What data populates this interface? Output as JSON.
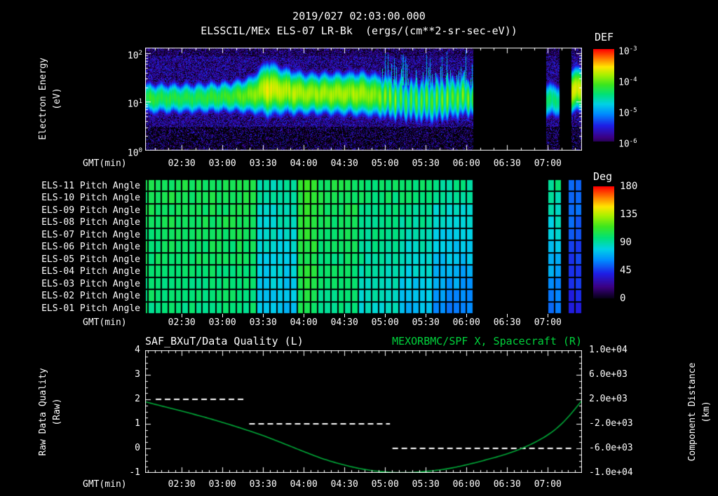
{
  "header": {
    "title": "2019/027 02:03:00.000",
    "subtitle": "ELSSCIL/MEx ELS-07 LR-Bk  (ergs/(cm**2-sr-sec-eV))"
  },
  "time_axis": {
    "label": "GMT(min)",
    "start_hour": 2.05,
    "end_hour": 7.42,
    "tick_hours": [
      2.5,
      3,
      3.5,
      4,
      4.5,
      5,
      5.5,
      6,
      6.5,
      7
    ],
    "tick_labels": [
      "02:30",
      "03:00",
      "03:30",
      "04:00",
      "04:30",
      "05:00",
      "05:30",
      "06:00",
      "06:30",
      "07:00"
    ]
  },
  "colors": {
    "background": "#000000",
    "text": "#ffffff",
    "green_accent": "#00d23c",
    "curve_green": "#00a838"
  },
  "chart_data": [
    {
      "id": "electron_spectrogram",
      "type": "heatmap",
      "ylabel": "Electron Energy\n(eV)",
      "yscale": "log",
      "ylim": [
        1,
        130
      ],
      "ytick_values": [
        1,
        10,
        100
      ],
      "ytick_labels": [
        "10^0",
        "10^1",
        "10^2"
      ],
      "units": "ergs/(cm**2-sr-sec-eV)",
      "colorbar": {
        "label": "DEF",
        "scale": "log",
        "min": 1e-06,
        "max": 0.001,
        "tick_labels": [
          "10^-3",
          "10^-4",
          "10^-5",
          "10^-6"
        ]
      },
      "gaps_hours": [
        [
          6.08,
          6.98
        ],
        [
          7.14,
          7.29
        ]
      ],
      "background_log10_flux_range": [
        -6.35,
        -5.4
      ],
      "striation_window_hours": [
        4.95,
        6.08
      ],
      "high_energy_wisp_hours": [
        4.95,
        6.08
      ],
      "band_keyframes": [
        {
          "t": 2.05,
          "center_ev": 12,
          "sigma_dec": 0.26,
          "peak_log10": -4.25
        },
        {
          "t": 2.6,
          "center_ev": 12,
          "sigma_dec": 0.26,
          "peak_log10": -4.3
        },
        {
          "t": 3.1,
          "center_ev": 13,
          "sigma_dec": 0.26,
          "peak_log10": -4.2
        },
        {
          "t": 3.35,
          "center_ev": 14,
          "sigma_dec": 0.3,
          "peak_log10": -4.0
        },
        {
          "t": 3.55,
          "center_ev": 19,
          "sigma_dec": 0.42,
          "peak_log10": -3.65
        },
        {
          "t": 3.75,
          "center_ev": 17,
          "sigma_dec": 0.36,
          "peak_log10": -3.8
        },
        {
          "t": 4.0,
          "center_ev": 15,
          "sigma_dec": 0.33,
          "peak_log10": -3.85
        },
        {
          "t": 4.3,
          "center_ev": 15,
          "sigma_dec": 0.33,
          "peak_log10": -3.9
        },
        {
          "t": 4.7,
          "center_ev": 15,
          "sigma_dec": 0.35,
          "peak_log10": -3.85
        },
        {
          "t": 5.0,
          "center_ev": 13,
          "sigma_dec": 0.35,
          "peak_log10": -4.0
        },
        {
          "t": 5.25,
          "center_ev": 11,
          "sigma_dec": 0.36,
          "peak_log10": -4.35
        },
        {
          "t": 5.6,
          "center_ev": 11,
          "sigma_dec": 0.38,
          "peak_log10": -4.25
        },
        {
          "t": 5.95,
          "center_ev": 13,
          "sigma_dec": 0.34,
          "peak_log10": -4.15
        },
        {
          "t": 6.08,
          "center_ev": 12,
          "sigma_dec": 0.3,
          "peak_log10": -4.3
        },
        {
          "t": 6.98,
          "center_ev": 11,
          "sigma_dec": 0.32,
          "peak_log10": -4.4
        },
        {
          "t": 7.14,
          "center_ev": 11,
          "sigma_dec": 0.3,
          "peak_log10": -4.5
        },
        {
          "t": 7.29,
          "center_ev": 17,
          "sigma_dec": 0.34,
          "peak_log10": -3.7
        },
        {
          "t": 7.42,
          "center_ev": 19,
          "sigma_dec": 0.34,
          "peak_log10": -3.75
        }
      ]
    },
    {
      "id": "pitch_angle_panels",
      "type": "heatmap",
      "rows": [
        "ELS-11 Pitch Angle",
        "ELS-10 Pitch Angle",
        "ELS-09 Pitch Angle",
        "ELS-08 Pitch Angle",
        "ELS-07 Pitch Angle",
        "ELS-06 Pitch Angle",
        "ELS-05 Pitch Angle",
        "ELS-04 Pitch Angle",
        "ELS-03 Pitch Angle",
        "ELS-02 Pitch Angle",
        "ELS-01 Pitch Angle"
      ],
      "colorbar": {
        "label": "Deg",
        "min": 0,
        "max": 180,
        "tick_labels": [
          "180",
          "135",
          "90",
          "45",
          "0"
        ]
      },
      "cell_minutes": 5,
      "gaps_hours": [
        [
          6.1,
          6.98
        ],
        [
          7.15,
          7.24
        ]
      ],
      "column_segments": [
        {
          "t0": 2.05,
          "t1": 3.4,
          "top_deg": 105,
          "bottom_deg": 97
        },
        {
          "t0": 3.4,
          "t1": 3.95,
          "top_deg": 90,
          "bottom_deg": 74
        },
        {
          "t0": 3.95,
          "t1": 4.15,
          "top_deg": 112,
          "bottom_deg": 104
        },
        {
          "t0": 4.15,
          "t1": 4.7,
          "top_deg": 104,
          "bottom_deg": 95
        },
        {
          "t0": 4.7,
          "t1": 5.15,
          "top_deg": 100,
          "bottom_deg": 85
        },
        {
          "t0": 5.15,
          "t1": 5.6,
          "top_deg": 100,
          "bottom_deg": 72
        },
        {
          "t0": 5.6,
          "t1": 6.1,
          "top_deg": 93,
          "bottom_deg": 60
        },
        {
          "t0": 6.98,
          "t1": 7.15,
          "top_deg": 95,
          "bottom_deg": 55
        },
        {
          "t0": 7.24,
          "t1": 7.43,
          "top_deg": 56,
          "bottom_deg": 40
        }
      ]
    },
    {
      "id": "quality_and_distance",
      "type": "line",
      "title_left": "SAF_BXuT/Data Quality (L)",
      "title_right": "MEXORBMC/SPF X, Spacecraft (R)",
      "ylabel_left": "Raw Data Quality\n(Raw)",
      "ylabel_right": "Component Distance\n(km)",
      "ylim_left": [
        -1,
        4
      ],
      "ytick_values_left": [
        4,
        3,
        2,
        1,
        0,
        -1
      ],
      "ytick_labels_left": [
        "4",
        "3",
        "2",
        "1",
        "0",
        "-1"
      ],
      "ytick_labels_right": [
        "1.0e+04",
        "6.0e+03",
        "2.0e+03",
        "-2.0e+03",
        "-6.0e+03",
        "-1.0e+04"
      ],
      "series": [
        {
          "name": "SAF_BXuT/Data Quality",
          "axis": "left",
          "style": "dashed",
          "color": "#ffffff",
          "segments": [
            {
              "t0": 2.18,
              "t1": 3.29,
              "value": 2
            },
            {
              "t0": 3.33,
              "t1": 5.06,
              "value": 1
            },
            {
              "t0": 5.09,
              "t1": 7.33,
              "value": 0
            }
          ]
        },
        {
          "name": "MEXORBMC/SPF X, Spacecraft",
          "axis": "right",
          "style": "solid",
          "color": "#00a838",
          "points": [
            [
              2.05,
              1.9
            ],
            [
              2.25,
              1.73
            ],
            [
              2.5,
              1.52
            ],
            [
              2.75,
              1.3
            ],
            [
              3.0,
              1.06
            ],
            [
              3.25,
              0.8
            ],
            [
              3.5,
              0.52
            ],
            [
              3.75,
              0.2
            ],
            [
              4.0,
              -0.13
            ],
            [
              4.25,
              -0.44
            ],
            [
              4.5,
              -0.68
            ],
            [
              4.75,
              -0.86
            ],
            [
              5.0,
              -0.96
            ],
            [
              5.25,
              -0.99
            ],
            [
              5.5,
              -0.94
            ],
            [
              5.75,
              -0.84
            ],
            [
              6.0,
              -0.67
            ],
            [
              6.25,
              -0.46
            ],
            [
              6.5,
              -0.22
            ],
            [
              6.75,
              0.1
            ],
            [
              7.0,
              0.55
            ],
            [
              7.2,
              1.1
            ],
            [
              7.42,
              1.95
            ]
          ]
        }
      ]
    }
  ]
}
